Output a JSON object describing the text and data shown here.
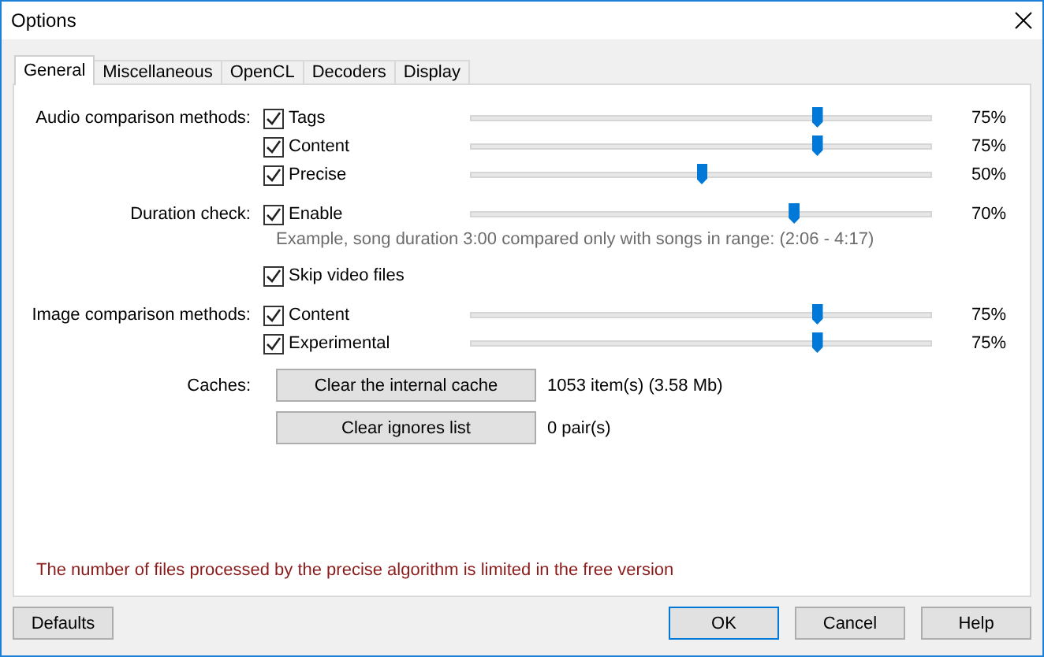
{
  "window": {
    "title": "Options"
  },
  "tabs": [
    {
      "label": "General",
      "selected": true
    },
    {
      "label": "Miscellaneous",
      "selected": false
    },
    {
      "label": "OpenCL",
      "selected": false
    },
    {
      "label": "Decoders",
      "selected": false
    },
    {
      "label": "Display",
      "selected": false
    }
  ],
  "sections": [
    {
      "label": "Audio comparison methods:",
      "options": [
        {
          "label": "Tags",
          "checked": true,
          "level": 0.75,
          "reading": "75%"
        },
        {
          "label": "Content",
          "checked": true,
          "level": 0.75,
          "reading": "75%"
        },
        {
          "label": "Precise",
          "checked": true,
          "level": 0.5,
          "reading": "50%"
        }
      ]
    },
    {
      "label": "Duration check:",
      "options": [
        {
          "label": "Enable",
          "checked": true,
          "level": 0.7,
          "reading": "70%"
        }
      ],
      "note": "Example, song duration 3:00 compared only with songs in range: (2:06 - 4:17)"
    },
    {
      "options": [
        {
          "label": "Skip video files",
          "checked": true
        }
      ]
    },
    {
      "label": "Image comparison methods:",
      "options": [
        {
          "label": "Content",
          "checked": true,
          "level": 0.75,
          "reading": "75%"
        },
        {
          "label": "Experimental",
          "checked": true,
          "level": 0.75,
          "reading": "75%"
        }
      ]
    }
  ],
  "caches": {
    "label": "Caches:",
    "actions": [
      {
        "button": "Clear the internal cache",
        "info": "1053 item(s) (3.58 Mb)"
      },
      {
        "button": "Clear ignores list",
        "info": "0 pair(s)"
      }
    ]
  },
  "notice": "The number of files processed by the precise algorithm is limited in the free version",
  "buttons": [
    {
      "label": "Defaults",
      "default": false
    },
    {
      "label": "OK",
      "default": true
    },
    {
      "label": "Cancel",
      "default": false
    },
    {
      "label": "Help",
      "default": false
    }
  ]
}
